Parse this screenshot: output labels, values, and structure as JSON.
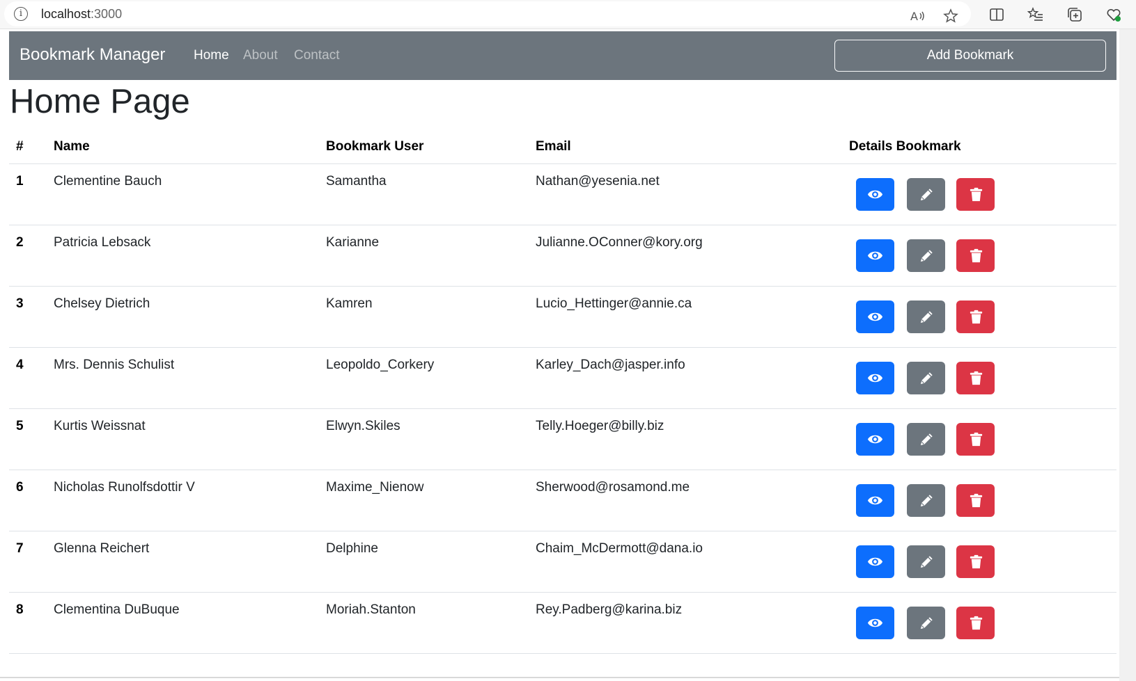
{
  "browser": {
    "url_host": "localhost",
    "url_port": ":3000"
  },
  "navbar": {
    "brand": "Bookmark Manager",
    "links": [
      {
        "label": "Home",
        "active": true
      },
      {
        "label": "About",
        "active": false
      },
      {
        "label": "Contact",
        "active": false
      }
    ],
    "add_button": "Add Bookmark"
  },
  "page_title": "Home Page",
  "table": {
    "headers": [
      "#",
      "Name",
      "Bookmark User",
      "Email",
      "Details Bookmark"
    ],
    "rows": [
      {
        "num": "1",
        "name": "Clementine Bauch",
        "user": "Samantha",
        "email": "Nathan@yesenia.net"
      },
      {
        "num": "2",
        "name": "Patricia Lebsack",
        "user": "Karianne",
        "email": "Julianne.OConner@kory.org"
      },
      {
        "num": "3",
        "name": "Chelsey Dietrich",
        "user": "Kamren",
        "email": "Lucio_Hettinger@annie.ca"
      },
      {
        "num": "4",
        "name": "Mrs. Dennis Schulist",
        "user": "Leopoldo_Corkery",
        "email": "Karley_Dach@jasper.info"
      },
      {
        "num": "5",
        "name": "Kurtis Weissnat",
        "user": "Elwyn.Skiles",
        "email": "Telly.Hoeger@billy.biz"
      },
      {
        "num": "6",
        "name": "Nicholas Runolfsdottir V",
        "user": "Maxime_Nienow",
        "email": "Sherwood@rosamond.me"
      },
      {
        "num": "7",
        "name": "Glenna Reichert",
        "user": "Delphine",
        "email": "Chaim_McDermott@dana.io"
      },
      {
        "num": "8",
        "name": "Clementina DuBuque",
        "user": "Moriah.Stanton",
        "email": "Rey.Padberg@karina.biz"
      }
    ],
    "actions": [
      {
        "name": "view",
        "icon": "eye-icon",
        "color": "#0d6efd"
      },
      {
        "name": "edit",
        "icon": "pencil-icon",
        "color": "#6c757d"
      },
      {
        "name": "delete",
        "icon": "trash-icon",
        "color": "#dc3545"
      }
    ]
  },
  "colors": {
    "navbar_bg": "#6c757d",
    "primary": "#0d6efd",
    "secondary": "#6c757d",
    "danger": "#dc3545"
  }
}
